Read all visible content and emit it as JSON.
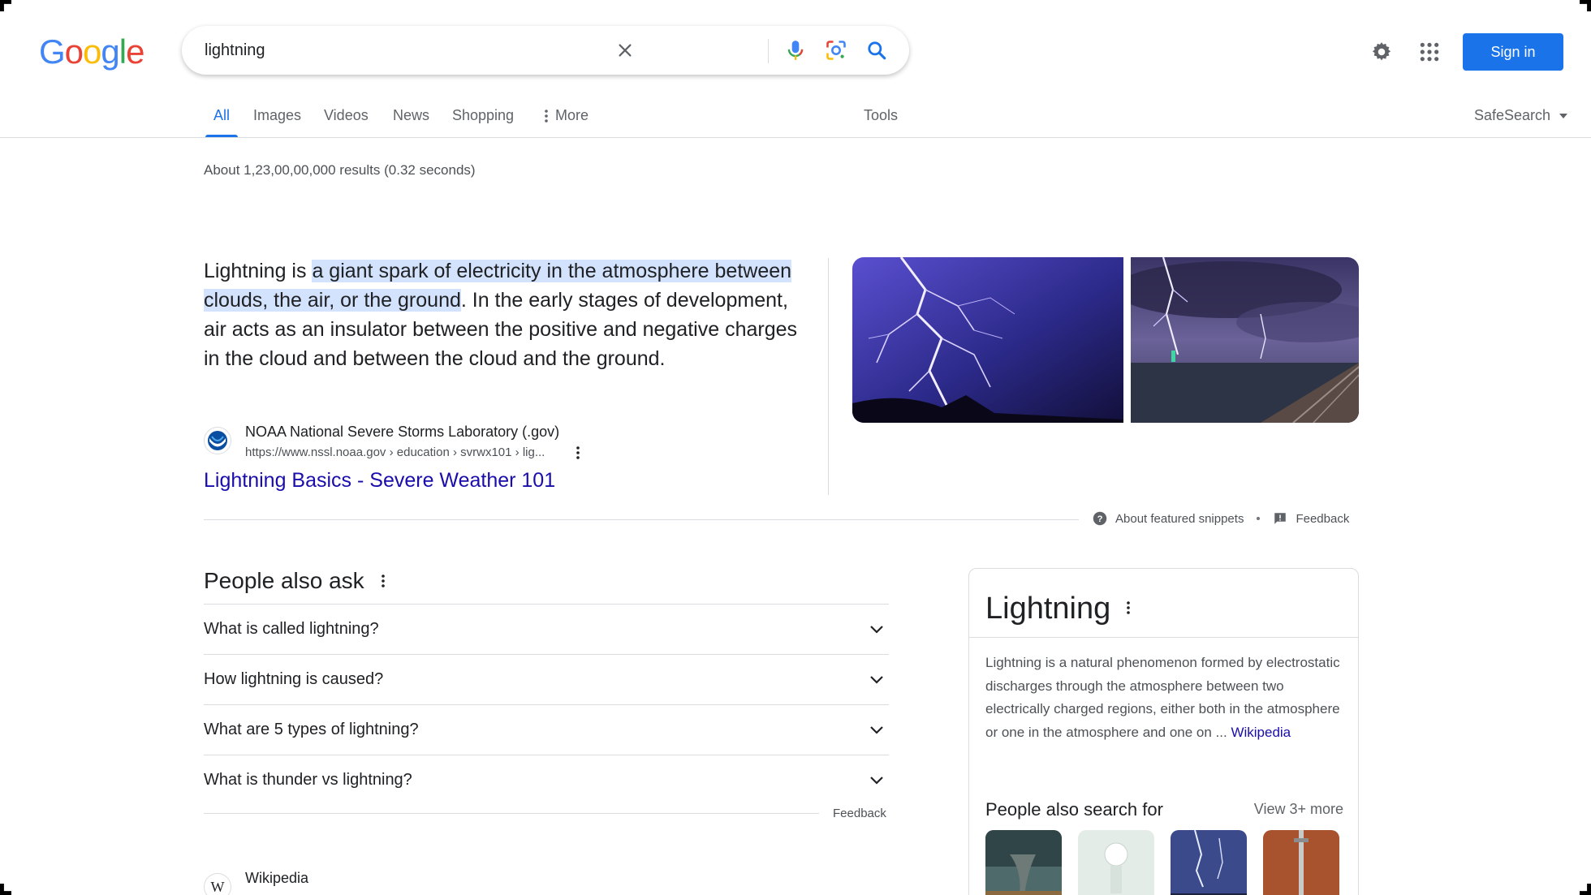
{
  "header": {
    "logo_letters": [
      "G",
      "o",
      "o",
      "g",
      "l",
      "e"
    ],
    "search_value": "lightning",
    "sign_in_label": "Sign in"
  },
  "nav": {
    "tabs": [
      {
        "label": "All",
        "active": true
      },
      {
        "label": "Images"
      },
      {
        "label": "Videos"
      },
      {
        "label": "News"
      },
      {
        "label": "Shopping"
      },
      {
        "label": "More"
      }
    ],
    "tools_label": "Tools",
    "safesearch_label": "SafeSearch"
  },
  "results_stats": "About 1,23,00,00,000 results (0.32 seconds)",
  "featured_snippet": {
    "prefix": "Lightning is ",
    "highlight": "a giant spark of electricity in the atmosphere between clouds, the air, or the ground",
    "suffix": ". In the early stages of development, air acts as an insulator between the positive and negative charges in the cloud and between the cloud and the ground.",
    "source_name": "NOAA National Severe Storms Laboratory (.gov)",
    "source_url": "https://www.nssl.noaa.gov › education › svrwx101 › lig...",
    "link_title": "Lightning Basics - Severe Weather 101",
    "about_label": "About featured snippets",
    "feedback_label": "Feedback"
  },
  "people_also_ask": {
    "title": "People also ask",
    "questions": [
      "What is called lightning?",
      "How lightning is caused?",
      "What are 5 types of lightning?",
      "What is thunder vs lightning?"
    ],
    "feedback_label": "Feedback"
  },
  "next_result": {
    "favicon_letter": "W",
    "site_name": "Wikipedia"
  },
  "knowledge_panel": {
    "title": "Lightning",
    "description": "Lightning is a natural phenomenon formed by electrostatic discharges through the atmosphere between two electrically charged regions, either both in the atmosphere or one in the atmosphere and one on ... ",
    "description_link": "Wikipedia",
    "pasf_title": "People also search for",
    "view_more_label": "View 3+ more"
  },
  "colors": {
    "accent": "#1a73e8",
    "link": "#1a0dab",
    "highlight": "#d3e3fd"
  }
}
